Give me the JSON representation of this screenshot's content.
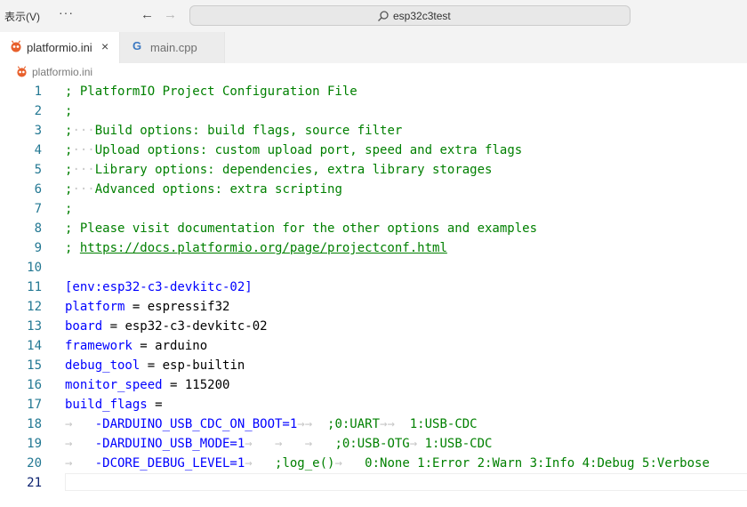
{
  "titlebar": {
    "menu_label": "表示(V)",
    "more": "···",
    "command_center": "esp32c3test"
  },
  "tabs": [
    {
      "label": "platformio.ini",
      "active": true,
      "close": "×"
    },
    {
      "label": "main.cpp",
      "active": false,
      "icon": "G"
    }
  ],
  "breadcrumb": {
    "file": "platformio.ini"
  },
  "editor": {
    "lines": [
      {
        "n": "1",
        "tokens": [
          {
            "t": "; PlatformIO Project Configuration File",
            "c": "comment"
          }
        ]
      },
      {
        "n": "2",
        "tokens": [
          {
            "t": ";",
            "c": "comment"
          }
        ]
      },
      {
        "n": "3",
        "tokens": [
          {
            "t": ";",
            "c": "comment"
          },
          {
            "t": "···",
            "c": "ws"
          },
          {
            "t": "Build options: build flags, source filter",
            "c": "comment"
          }
        ]
      },
      {
        "n": "4",
        "tokens": [
          {
            "t": ";",
            "c": "comment"
          },
          {
            "t": "···",
            "c": "ws"
          },
          {
            "t": "Upload options: custom upload port, speed and extra flags",
            "c": "comment"
          }
        ]
      },
      {
        "n": "5",
        "tokens": [
          {
            "t": ";",
            "c": "comment"
          },
          {
            "t": "···",
            "c": "ws"
          },
          {
            "t": "Library options: dependencies, extra library storages",
            "c": "comment"
          }
        ]
      },
      {
        "n": "6",
        "tokens": [
          {
            "t": ";",
            "c": "comment"
          },
          {
            "t": "···",
            "c": "ws"
          },
          {
            "t": "Advanced options: extra scripting",
            "c": "comment"
          }
        ]
      },
      {
        "n": "7",
        "tokens": [
          {
            "t": ";",
            "c": "comment"
          }
        ]
      },
      {
        "n": "8",
        "tokens": [
          {
            "t": "; Please visit documentation for the other options and examples",
            "c": "comment"
          }
        ]
      },
      {
        "n": "9",
        "tokens": [
          {
            "t": "; ",
            "c": "comment"
          },
          {
            "t": "https://docs.platformio.org/page/projectconf.html",
            "c": "url"
          }
        ]
      },
      {
        "n": "10",
        "tokens": []
      },
      {
        "n": "11",
        "tokens": [
          {
            "t": "[env:esp32-c3-devkitc-02]",
            "c": "key"
          }
        ]
      },
      {
        "n": "12",
        "tokens": [
          {
            "t": "platform",
            "c": "key"
          },
          {
            "t": " = espressif32",
            "c": "plain"
          }
        ]
      },
      {
        "n": "13",
        "tokens": [
          {
            "t": "board",
            "c": "key"
          },
          {
            "t": " = esp32-c3-devkitc-02",
            "c": "plain"
          }
        ]
      },
      {
        "n": "14",
        "tokens": [
          {
            "t": "framework",
            "c": "key"
          },
          {
            "t": " = arduino",
            "c": "plain"
          }
        ]
      },
      {
        "n": "15",
        "tokens": [
          {
            "t": "debug_tool",
            "c": "key"
          },
          {
            "t": " = esp-builtin",
            "c": "plain"
          }
        ]
      },
      {
        "n": "16",
        "tokens": [
          {
            "t": "monitor_speed",
            "c": "key"
          },
          {
            "t": " = 115200",
            "c": "plain"
          }
        ]
      },
      {
        "n": "17",
        "tokens": [
          {
            "t": "build_flags",
            "c": "key"
          },
          {
            "t": " =",
            "c": "plain"
          }
        ]
      },
      {
        "n": "18",
        "tokens": [
          {
            "t": "→   ",
            "c": "ws"
          },
          {
            "t": "-DARDUINO_USB_CDC_ON_BOOT=1",
            "c": "key"
          },
          {
            "t": "→→  ",
            "c": "ws"
          },
          {
            "t": ";0:UART",
            "c": "comment"
          },
          {
            "t": "→→  ",
            "c": "ws"
          },
          {
            "t": "1:USB-CDC",
            "c": "comment"
          }
        ]
      },
      {
        "n": "19",
        "tokens": [
          {
            "t": "→   ",
            "c": "ws"
          },
          {
            "t": "-DARDUINO_USB_MODE=1",
            "c": "key"
          },
          {
            "t": "→   →   →   ",
            "c": "ws"
          },
          {
            "t": ";0:USB-OTG",
            "c": "comment"
          },
          {
            "t": "→ ",
            "c": "ws"
          },
          {
            "t": "1:USB-CDC",
            "c": "comment"
          }
        ]
      },
      {
        "n": "20",
        "tokens": [
          {
            "t": "→   ",
            "c": "ws"
          },
          {
            "t": "-DCORE_DEBUG_LEVEL=1",
            "c": "key"
          },
          {
            "t": "→   ",
            "c": "ws"
          },
          {
            "t": ";log_e()",
            "c": "comment"
          },
          {
            "t": "→   ",
            "c": "ws"
          },
          {
            "t": "0:None 1:Error 2:Warn 3:Info 4:Debug 5:Verbose",
            "c": "comment"
          }
        ]
      },
      {
        "n": "21",
        "tokens": [],
        "current": true
      }
    ]
  }
}
